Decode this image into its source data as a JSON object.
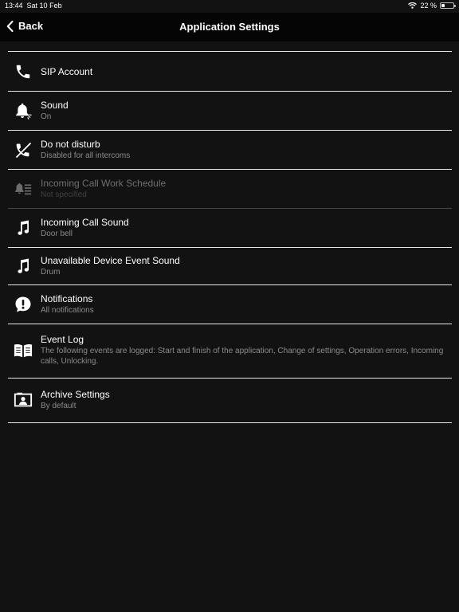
{
  "status_bar": {
    "time": "13:44",
    "date": "Sat 10 Feb",
    "battery": "22 %"
  },
  "nav": {
    "back_label": "Back",
    "title": "Application Settings"
  },
  "items": [
    {
      "title": "SIP Account",
      "subtitle": "",
      "icon": "phone-icon",
      "enabled": true
    },
    {
      "title": "Sound",
      "subtitle": "On",
      "icon": "bell-icon",
      "enabled": true
    },
    {
      "title": "Do not disturb",
      "subtitle": "Disabled for all intercoms",
      "icon": "phone-off-icon",
      "enabled": true
    },
    {
      "title": "Incoming Call Work Schedule",
      "subtitle": "Not specified",
      "icon": "bell-schedule-icon",
      "enabled": false
    },
    {
      "title": "Incoming Call Sound",
      "subtitle": "Door bell",
      "icon": "music-note-icon",
      "enabled": true
    },
    {
      "title": "Unavailable Device Event Sound",
      "subtitle": "Drum",
      "icon": "music-note-icon",
      "enabled": true
    },
    {
      "title": "Notifications",
      "subtitle": "All notifications",
      "icon": "alert-bubble-icon",
      "enabled": true
    },
    {
      "title": "Event Log",
      "subtitle": "The following events are logged: Start and finish of the application, Change of settings, Operation errors, Incoming calls, Unlocking.",
      "icon": "book-icon",
      "enabled": true
    },
    {
      "title": "Archive Settings",
      "subtitle": "By default",
      "icon": "archive-user-icon",
      "enabled": true
    }
  ],
  "colors": {
    "background": "#121212",
    "navbar": "#050505",
    "divider": "#e8e8e8",
    "subtitle": "#8b8b8b"
  }
}
